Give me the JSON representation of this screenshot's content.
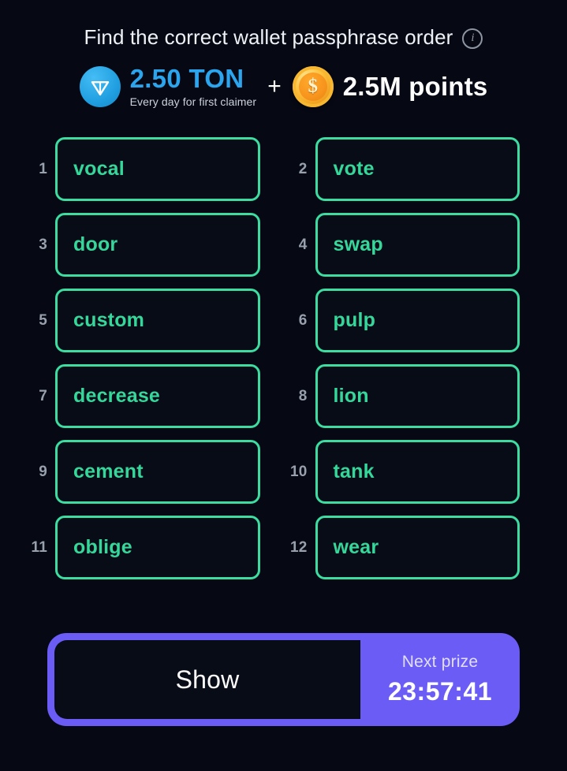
{
  "header": {
    "title": "Find the correct wallet passphrase order",
    "info_icon": "info-icon",
    "info_glyph": "i"
  },
  "prize": {
    "ton_icon": "ton-logo-icon",
    "ton_amount": "2.50 TON",
    "ton_subtitle": "Every day for first claimer",
    "separator": "+",
    "coin_icon": "dollar-coin-icon",
    "coin_glyph": "$",
    "points_amount": "2.5M points",
    "ton_color": "#2ba5ee",
    "points_color": "#ffffff"
  },
  "words": [
    {
      "index": "1",
      "word": "vocal"
    },
    {
      "index": "2",
      "word": "vote"
    },
    {
      "index": "3",
      "word": "door"
    },
    {
      "index": "4",
      "word": "swap"
    },
    {
      "index": "5",
      "word": "custom"
    },
    {
      "index": "6",
      "word": "pulp"
    },
    {
      "index": "7",
      "word": "decrease"
    },
    {
      "index": "8",
      "word": "lion"
    },
    {
      "index": "9",
      "word": "cement"
    },
    {
      "index": "10",
      "word": "tank"
    },
    {
      "index": "11",
      "word": "oblige"
    },
    {
      "index": "12",
      "word": "wear"
    }
  ],
  "footer": {
    "show_label": "Show",
    "next_prize_label": "Next prize",
    "timer": "23:57:41",
    "accent_color": "#6a5cf5"
  },
  "theme": {
    "background": "#060914",
    "word_border": "#3ddca0",
    "word_text": "#35d79a",
    "index_text": "#98a0ae"
  }
}
